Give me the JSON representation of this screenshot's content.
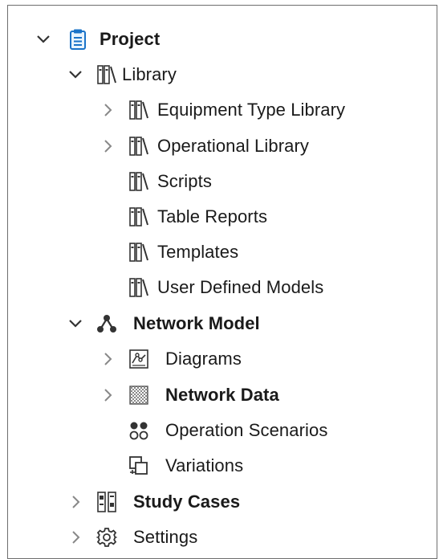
{
  "tree": {
    "project": {
      "label": "Project",
      "icon": "clipboard-icon",
      "state": "expanded"
    },
    "library": {
      "label": "Library",
      "icon": "library-books-icon",
      "state": "expanded"
    },
    "library_items": [
      {
        "label": "Equipment Type Library",
        "icon": "library-books-icon",
        "state": "collapsed"
      },
      {
        "label": "Operational Library",
        "icon": "library-books-icon",
        "state": "collapsed"
      },
      {
        "label": "Scripts",
        "icon": "library-books-icon",
        "state": "leaf"
      },
      {
        "label": "Table Reports",
        "icon": "library-books-icon",
        "state": "leaf"
      },
      {
        "label": "Templates",
        "icon": "library-books-icon",
        "state": "leaf"
      },
      {
        "label": "User Defined Models",
        "icon": "library-books-icon",
        "state": "leaf"
      }
    ],
    "network_model": {
      "label": "Network Model",
      "icon": "network-nodes-icon",
      "state": "expanded"
    },
    "network_items": [
      {
        "label": "Diagrams",
        "icon": "diagram-icon",
        "state": "collapsed"
      },
      {
        "label": "Network Data",
        "icon": "grid-data-icon",
        "state": "collapsed"
      },
      {
        "label": "Operation Scenarios",
        "icon": "scenario-dots-icon",
        "state": "leaf"
      },
      {
        "label": "Variations",
        "icon": "variations-icon",
        "state": "leaf"
      }
    ],
    "study_cases": {
      "label": "Study Cases",
      "icon": "study-cases-icon",
      "state": "collapsed"
    },
    "settings": {
      "label": "Settings",
      "icon": "gear-icon",
      "state": "collapsed"
    }
  }
}
